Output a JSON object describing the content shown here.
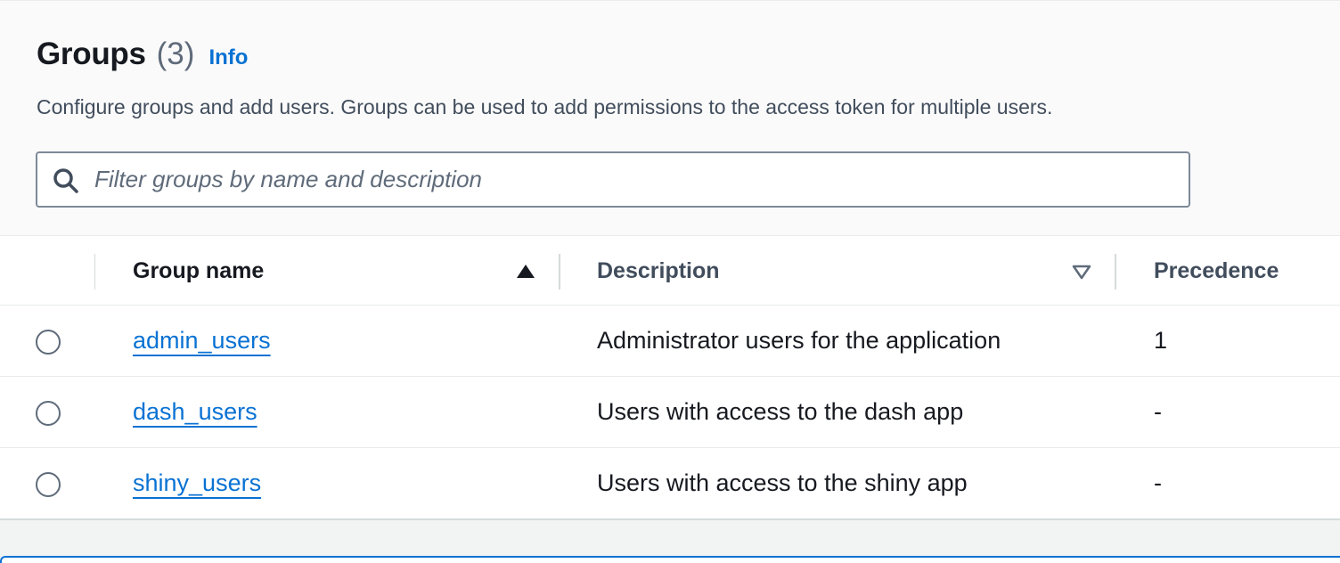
{
  "header": {
    "title": "Groups",
    "count": "(3)",
    "info_label": "Info",
    "description": "Configure groups and add users. Groups can be used to add permissions to the access token for multiple users."
  },
  "search": {
    "placeholder": "Filter groups by name and description",
    "value": ""
  },
  "table": {
    "columns": {
      "group_name": "Group name",
      "description": "Description",
      "precedence": "Precedence"
    },
    "sort": {
      "column": "Group name",
      "direction": "ascending"
    },
    "rows": [
      {
        "name": "admin_users",
        "description": "Administrator users for the application",
        "precedence": "1",
        "selected": false
      },
      {
        "name": "dash_users",
        "description": "Users with access to the dash app",
        "precedence": "-",
        "selected": false
      },
      {
        "name": "shiny_users",
        "description": "Users with access to the shiny app",
        "precedence": "-",
        "selected": false
      }
    ]
  },
  "colors": {
    "link": "#0972d3",
    "text": "#16191f",
    "muted": "#5f6b7a"
  },
  "icons": {
    "search": "search-icon",
    "sort_ascending": "caret-up-filled-icon",
    "sort_descending": "caret-down-outline-icon"
  }
}
